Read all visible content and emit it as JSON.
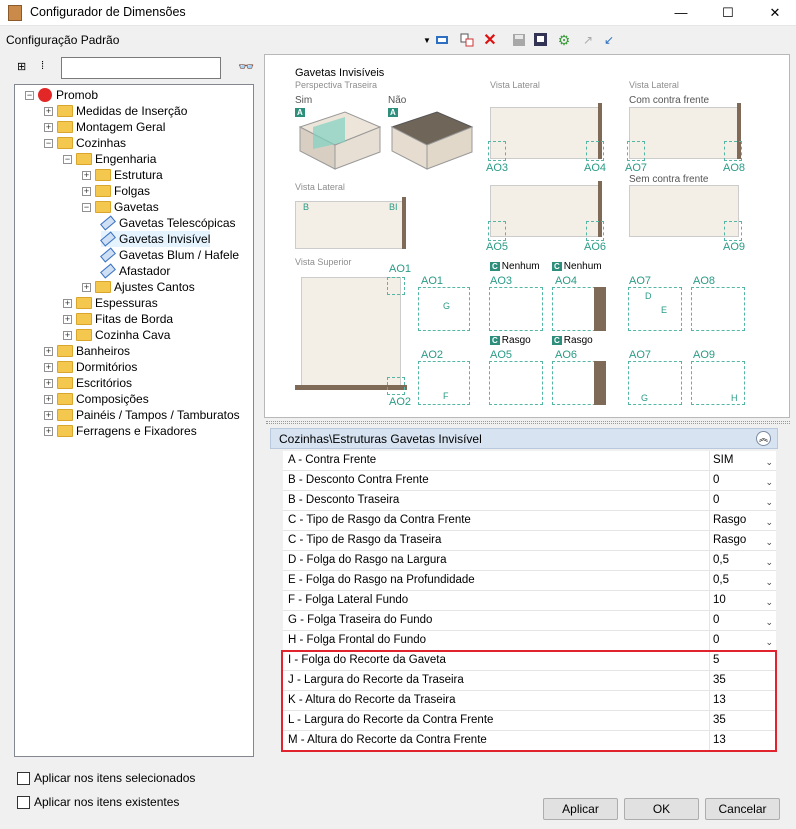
{
  "window": {
    "title": "Configurador de Dimensões",
    "minimize": "—",
    "maximize": "☐",
    "close": "✕"
  },
  "config_label": "Configuração Padrão",
  "search": {
    "value": ""
  },
  "tree": [
    {
      "label": "Promob",
      "level": 0
    },
    {
      "label": "Medidas de Inserção",
      "level": 1
    },
    {
      "label": "Montagem Geral",
      "level": 1
    },
    {
      "label": "Cozinhas",
      "level": 1
    },
    {
      "label": "Engenharia",
      "level": 2
    },
    {
      "label": "Estrutura",
      "level": 3
    },
    {
      "label": "Folgas",
      "level": 3
    },
    {
      "label": "Gavetas",
      "level": 3
    },
    {
      "label": "Gavetas Telescópicas",
      "level": 4
    },
    {
      "label": "Gavetas Invisível",
      "level": 4
    },
    {
      "label": "Gavetas Blum / Hafele",
      "level": 4
    },
    {
      "label": "Afastador",
      "level": 4
    },
    {
      "label": "Ajustes Cantos",
      "level": 3
    },
    {
      "label": "Espessuras",
      "level": 2
    },
    {
      "label": "Fitas de Borda",
      "level": 2
    },
    {
      "label": "Cozinha Cava",
      "level": 2
    },
    {
      "label": "Banheiros",
      "level": 1
    },
    {
      "label": "Dormitórios",
      "level": 1
    },
    {
      "label": "Escritórios",
      "level": 1
    },
    {
      "label": "Composições",
      "level": 1
    },
    {
      "label": "Painéis / Tampos / Tamburatos",
      "level": 1
    },
    {
      "label": "Ferragens e  Fixadores",
      "level": 1
    }
  ],
  "diagram": {
    "title": "Gavetas Invisíveis",
    "subtitle": "Perspectiva Traseira",
    "sim": "Sim",
    "nao": "Não",
    "tagA": "A",
    "vista_lateral": "Vista Lateral",
    "com_contra": "Com contra frente",
    "sem_contra": "Sem contra frente",
    "vista_superior": "Vista Superior",
    "nenhum": "Nenhum",
    "rasgo": "Rasgo",
    "tagC": "C",
    "codes": {
      "ao1": "AO1",
      "ao2": "AO2",
      "ao3": "AO3",
      "ao4": "AO4",
      "ao5": "AO5",
      "ao6": "AO6",
      "ao7": "AO7",
      "ao8": "AO8",
      "ao9": "AO9",
      "b": "B",
      "bi": "BI",
      "d": "D",
      "e": "E",
      "f": "F",
      "g": "G",
      "h": "H"
    }
  },
  "props": {
    "header": "Cozinhas\\Estruturas Gavetas Invisível",
    "rows": [
      {
        "label": "A - Contra Frente",
        "value": "SIM",
        "dropdown": true
      },
      {
        "label": "B - Desconto Contra Frente",
        "value": "0",
        "dropdown": true
      },
      {
        "label": "B - Desconto Traseira",
        "value": "0",
        "dropdown": true
      },
      {
        "label": "C - Tipo de Rasgo da Contra Frente",
        "value": "Rasgo",
        "dropdown": true
      },
      {
        "label": "C - Tipo de Rasgo da Traseira",
        "value": "Rasgo",
        "dropdown": true
      },
      {
        "label": "D - Folga do Rasgo na Largura",
        "value": "0,5",
        "dropdown": true
      },
      {
        "label": "E - Folga do Rasgo na Profundidade",
        "value": "0,5",
        "dropdown": true
      },
      {
        "label": "F - Folga Lateral Fundo",
        "value": "10",
        "dropdown": true
      },
      {
        "label": "G - Folga Traseira do Fundo",
        "value": "0",
        "dropdown": true
      },
      {
        "label": "H - Folga Frontal do Fundo",
        "value": "0",
        "dropdown": true
      },
      {
        "label": "I - Folga do Recorte da Gaveta",
        "value": "5",
        "dropdown": false
      },
      {
        "label": "J - Largura do Recorte da Traseira",
        "value": "35",
        "dropdown": false
      },
      {
        "label": "K - Altura do Recorte da Traseira",
        "value": "13",
        "dropdown": false
      },
      {
        "label": "L - Largura do Recorte da Contra Frente",
        "value": "35",
        "dropdown": false
      },
      {
        "label": "M - Altura do Recorte da Contra Frente",
        "value": "13",
        "dropdown": false
      }
    ]
  },
  "options": {
    "selected": "Aplicar nos itens selecionados",
    "existing": "Aplicar nos itens existentes"
  },
  "buttons": {
    "apply": "Aplicar",
    "ok": "OK",
    "cancel": "Cancelar"
  },
  "colors": {
    "accent": "#2a9b86",
    "highlight": "#e0232d",
    "header": "#d7e3f1"
  }
}
